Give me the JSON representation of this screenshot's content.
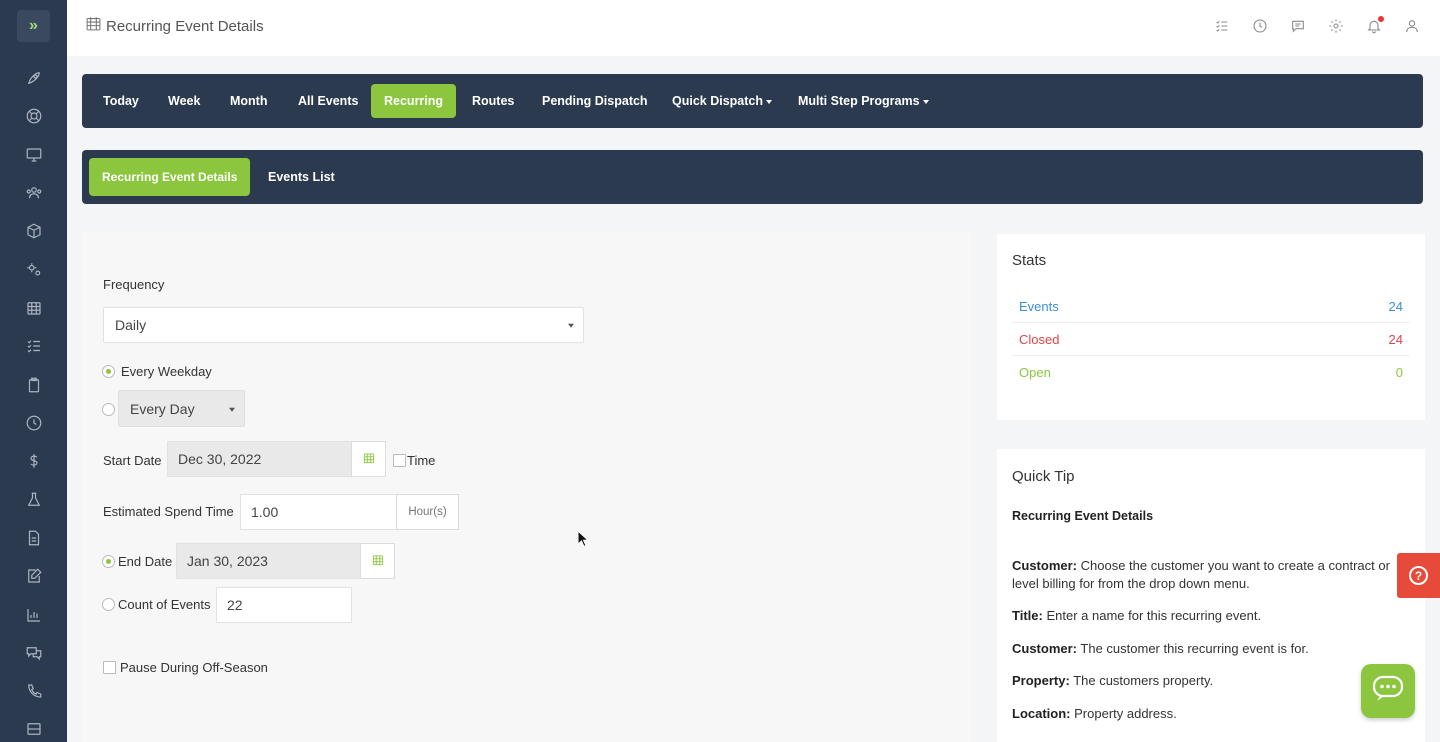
{
  "header": {
    "title": "Recurring Event Details"
  },
  "nav_main": {
    "items": [
      {
        "label": "Today"
      },
      {
        "label": "Week"
      },
      {
        "label": "Month"
      },
      {
        "label": "All Events"
      },
      {
        "label": "Recurring",
        "active": true
      },
      {
        "label": "Routes"
      },
      {
        "label": "Pending Dispatch"
      },
      {
        "label": "Quick Dispatch",
        "dropdown": true
      },
      {
        "label": "Multi Step Programs",
        "dropdown": true
      }
    ]
  },
  "nav_sub": {
    "items": [
      {
        "label": "Recurring Event Details",
        "active": true
      },
      {
        "label": "Events List"
      }
    ]
  },
  "form": {
    "frequency_label": "Frequency",
    "frequency_value": "Daily",
    "every_weekday_label": "Every Weekday",
    "every_day_value": "Every Day",
    "start_date_label": "Start Date",
    "start_date_value": "Dec 30, 2022",
    "time_label": "Time",
    "spend_label": "Estimated Spend Time",
    "spend_value": "1.00",
    "spend_unit": "Hour(s)",
    "end_date_label": "End Date",
    "end_date_value": "Jan 30, 2023",
    "count_label": "Count of Events",
    "count_value": "22",
    "pause_label": "Pause During Off-Season"
  },
  "stats": {
    "title": "Stats",
    "rows": [
      {
        "label": "Events",
        "value": "24",
        "color": "#3a8fd6"
      },
      {
        "label": "Closed",
        "value": "24",
        "color": "#e0434b"
      },
      {
        "label": "Open",
        "value": "0",
        "color": "#8cc63f"
      }
    ]
  },
  "tip": {
    "title": "Quick Tip",
    "subtitle": "Recurring Event Details",
    "lines": [
      {
        "key": "Customer:",
        "text": "Choose the customer you want to create a contract or level billing for from the drop down menu."
      },
      {
        "key": "Title:",
        "text": "Enter a name for this recurring event."
      },
      {
        "key": "Customer:",
        "text": "The customer this recurring event is for."
      },
      {
        "key": "Property:",
        "text": "The customers property."
      },
      {
        "key": "Location:",
        "text": "Property address."
      }
    ]
  },
  "colors": {
    "nav_bg": "#2c3a4f",
    "accent": "#8cc63f",
    "help": "#e84a3a"
  }
}
